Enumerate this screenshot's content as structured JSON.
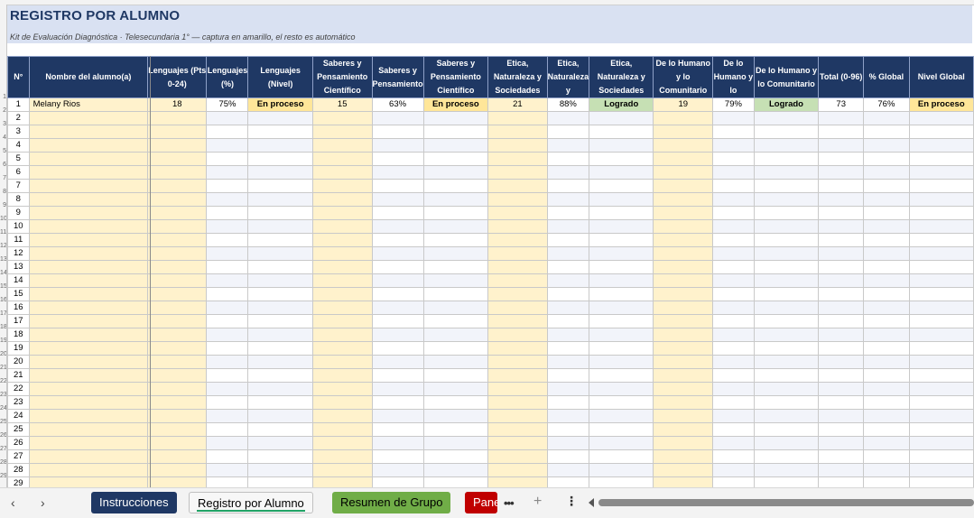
{
  "sheet": {
    "title": "REGISTRO POR ALUMNO",
    "subtitle": "Kit de Evaluación Diagnóstica · Telesecundaria 1° — captura en amarillo, el resto es automático"
  },
  "headers": [
    "N°",
    "Nombre del alumno(a)",
    "Lenguajes (Pts 0-24)",
    "Lenguajes (%)",
    "Lenguajes (Nivel)",
    "Saberes y Pensamiento Científico",
    "Saberes y Pensamiento",
    "Saberes y Pensamiento Científico",
    "Etica, Naturaleza y Sociedades",
    "Etica, Naturaleza y",
    "Etica, Naturaleza y Sociedades",
    "De lo Humano y lo Comunitario",
    "De lo Humano y lo",
    "De lo Humano y lo Comunitario",
    "Total (0-96)",
    "% Global",
    "Nivel Global"
  ],
  "rows": [
    [
      "1",
      "Melany Rios",
      "18",
      "75%",
      "En proceso",
      "15",
      "63%",
      "En proceso",
      "21",
      "88%",
      "Logrado",
      "19",
      "79%",
      "Logrado",
      "73",
      "76%",
      "En proceso"
    ],
    [
      "2",
      "",
      "",
      "",
      "",
      "",
      "",
      "",
      "",
      "",
      "",
      "",
      "",
      "",
      "",
      "",
      ""
    ],
    [
      "3",
      "",
      "",
      "",
      "",
      "",
      "",
      "",
      "",
      "",
      "",
      "",
      "",
      "",
      "",
      "",
      ""
    ],
    [
      "4",
      "",
      "",
      "",
      "",
      "",
      "",
      "",
      "",
      "",
      "",
      "",
      "",
      "",
      "",
      "",
      ""
    ],
    [
      "5",
      "",
      "",
      "",
      "",
      "",
      "",
      "",
      "",
      "",
      "",
      "",
      "",
      "",
      "",
      "",
      ""
    ],
    [
      "6",
      "",
      "",
      "",
      "",
      "",
      "",
      "",
      "",
      "",
      "",
      "",
      "",
      "",
      "",
      "",
      ""
    ],
    [
      "7",
      "",
      "",
      "",
      "",
      "",
      "",
      "",
      "",
      "",
      "",
      "",
      "",
      "",
      "",
      "",
      ""
    ],
    [
      "8",
      "",
      "",
      "",
      "",
      "",
      "",
      "",
      "",
      "",
      "",
      "",
      "",
      "",
      "",
      "",
      ""
    ],
    [
      "9",
      "",
      "",
      "",
      "",
      "",
      "",
      "",
      "",
      "",
      "",
      "",
      "",
      "",
      "",
      "",
      ""
    ],
    [
      "10",
      "",
      "",
      "",
      "",
      "",
      "",
      "",
      "",
      "",
      "",
      "",
      "",
      "",
      "",
      "",
      ""
    ],
    [
      "11",
      "",
      "",
      "",
      "",
      "",
      "",
      "",
      "",
      "",
      "",
      "",
      "",
      "",
      "",
      "",
      ""
    ],
    [
      "12",
      "",
      "",
      "",
      "",
      "",
      "",
      "",
      "",
      "",
      "",
      "",
      "",
      "",
      "",
      "",
      ""
    ],
    [
      "13",
      "",
      "",
      "",
      "",
      "",
      "",
      "",
      "",
      "",
      "",
      "",
      "",
      "",
      "",
      "",
      ""
    ],
    [
      "14",
      "",
      "",
      "",
      "",
      "",
      "",
      "",
      "",
      "",
      "",
      "",
      "",
      "",
      "",
      "",
      ""
    ],
    [
      "15",
      "",
      "",
      "",
      "",
      "",
      "",
      "",
      "",
      "",
      "",
      "",
      "",
      "",
      "",
      "",
      ""
    ],
    [
      "16",
      "",
      "",
      "",
      "",
      "",
      "",
      "",
      "",
      "",
      "",
      "",
      "",
      "",
      "",
      "",
      ""
    ],
    [
      "17",
      "",
      "",
      "",
      "",
      "",
      "",
      "",
      "",
      "",
      "",
      "",
      "",
      "",
      "",
      "",
      ""
    ],
    [
      "18",
      "",
      "",
      "",
      "",
      "",
      "",
      "",
      "",
      "",
      "",
      "",
      "",
      "",
      "",
      "",
      ""
    ],
    [
      "19",
      "",
      "",
      "",
      "",
      "",
      "",
      "",
      "",
      "",
      "",
      "",
      "",
      "",
      "",
      "",
      ""
    ],
    [
      "20",
      "",
      "",
      "",
      "",
      "",
      "",
      "",
      "",
      "",
      "",
      "",
      "",
      "",
      "",
      "",
      ""
    ],
    [
      "21",
      "",
      "",
      "",
      "",
      "",
      "",
      "",
      "",
      "",
      "",
      "",
      "",
      "",
      "",
      "",
      ""
    ],
    [
      "22",
      "",
      "",
      "",
      "",
      "",
      "",
      "",
      "",
      "",
      "",
      "",
      "",
      "",
      "",
      "",
      ""
    ],
    [
      "23",
      "",
      "",
      "",
      "",
      "",
      "",
      "",
      "",
      "",
      "",
      "",
      "",
      "",
      "",
      "",
      ""
    ],
    [
      "24",
      "",
      "",
      "",
      "",
      "",
      "",
      "",
      "",
      "",
      "",
      "",
      "",
      "",
      "",
      "",
      ""
    ],
    [
      "25",
      "",
      "",
      "",
      "",
      "",
      "",
      "",
      "",
      "",
      "",
      "",
      "",
      "",
      "",
      "",
      ""
    ],
    [
      "26",
      "",
      "",
      "",
      "",
      "",
      "",
      "",
      "",
      "",
      "",
      "",
      "",
      "",
      "",
      "",
      ""
    ],
    [
      "27",
      "",
      "",
      "",
      "",
      "",
      "",
      "",
      "",
      "",
      "",
      "",
      "",
      "",
      "",
      "",
      ""
    ],
    [
      "28",
      "",
      "",
      "",
      "",
      "",
      "",
      "",
      "",
      "",
      "",
      "",
      "",
      "",
      "",
      "",
      ""
    ],
    [
      "29",
      "",
      "",
      "",
      "",
      "",
      "",
      "",
      "",
      "",
      "",
      "",
      "",
      "",
      "",
      "",
      ""
    ]
  ],
  "tabs": {
    "instrucciones": "Instrucciones",
    "registro": "Registro por Alumno",
    "resumen": "Resumen de Grupo",
    "panel": "Panel"
  },
  "nav": {
    "prev": "‹",
    "next": "›",
    "more": "•••",
    "add": "+",
    "options": "⋮"
  },
  "colors": {
    "header_bg": "#1f3864",
    "input_yellow": "#fff2cc",
    "level_en_proceso": "#ffe699",
    "level_logrado": "#c6e0b4",
    "title_band": "#d9e1f2",
    "tab_instrucciones": "#1f3864",
    "tab_resumen": "#70ad47",
    "tab_panel": "#c00000"
  }
}
